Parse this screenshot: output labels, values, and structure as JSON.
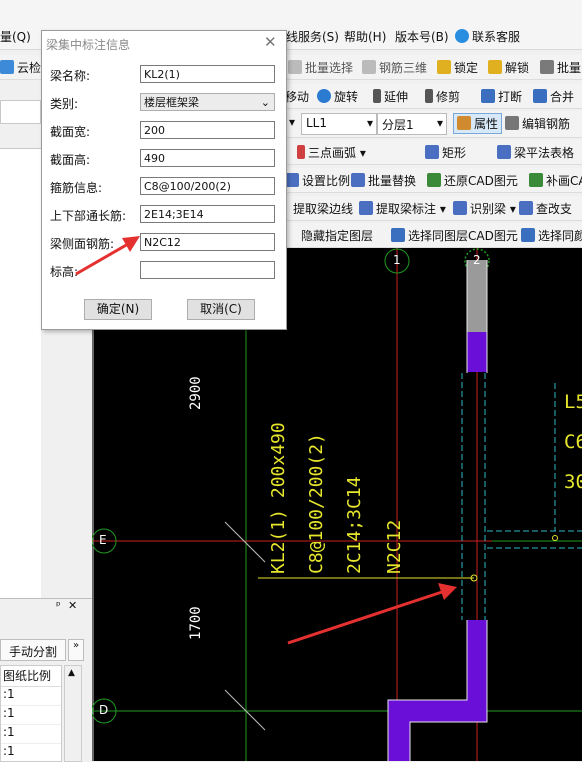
{
  "menu": {
    "items": [
      "量(Q)",
      "线服务(S)",
      "帮助(H)",
      "版本号(B)",
      "联系客服"
    ]
  },
  "toolbar1": {
    "cloud_check": "云检查",
    "batch_select": "批量选择",
    "rebar_3d": "钢筋三维",
    "lock": "锁定",
    "unlock": "解锁",
    "batch": "批量"
  },
  "toolbar2": {
    "move": "移动",
    "rotate": "旋转",
    "extend": "延伸",
    "trim": "修剪",
    "break": "打断",
    "merge": "合并"
  },
  "toolbar3": {
    "element": "LL1",
    "layer": "分层1",
    "property": "属性",
    "edit_rebar": "编辑钢筋"
  },
  "toolbar4": {
    "arc": "三点画弧",
    "rect": "矩形",
    "beam_table": "梁平法表格"
  },
  "toolbar5": {
    "set_scale": "设置比例",
    "batch_replace": "批量替换",
    "restore_cad": "还原CAD图元",
    "fill_cad": "补画CA"
  },
  "toolbar6": {
    "extract_edge": "提取梁边线",
    "extract_label": "提取梁标注",
    "identify_beam": "识别梁",
    "check_support": "查改支"
  },
  "toolbar7": {
    "hide_layer": "隐藏指定图层",
    "select_same_layer": "选择同图层CAD图元",
    "select_same_color": "选择同颜"
  },
  "dialog": {
    "title": "梁集中标注信息",
    "fields": [
      {
        "label": "梁名称:",
        "value": "KL2(1)"
      },
      {
        "label": "类别:",
        "value": "楼层框架梁"
      },
      {
        "label": "截面宽:",
        "value": "200"
      },
      {
        "label": "截面高:",
        "value": "490"
      },
      {
        "label": "箍筋信息:",
        "value": "C8@100/200(2)"
      },
      {
        "label": "上下部通长筋:",
        "value": "2E14;3E14"
      },
      {
        "label": "梁侧面钢筋:",
        "value": "N2C12"
      },
      {
        "label": "标高:",
        "value": ""
      }
    ],
    "ok": "确定(N)",
    "cancel": "取消(C)"
  },
  "left_panel": {
    "manual_split": "手动分割",
    "scale_header": "图纸比例",
    "rows": [
      ":1",
      ":1",
      ":1",
      ":1"
    ]
  },
  "cad": {
    "beam_lines": [
      "KL2(1) 200x490",
      "C8@100/200(2)",
      "2C14;3C14",
      "N2C12"
    ],
    "right_texts": [
      "L5",
      "C6",
      "30"
    ],
    "dim_2900": "2900",
    "dim_1700": "1700",
    "axis_1": "1",
    "axis_2": "2",
    "axis_e": "E",
    "axis_d": "D"
  },
  "colors": {
    "cad_text": "#e6e62d",
    "wall_purple": "#6a0fd8",
    "grid_green": "#1f9a1f",
    "arrow_red": "#e53030",
    "axis_red": "#cc2020",
    "cyan": "#2fb8c6"
  }
}
